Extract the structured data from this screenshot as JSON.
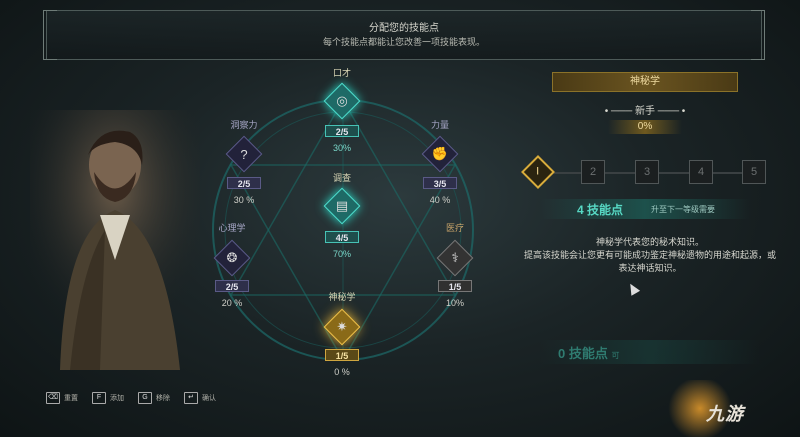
{
  "header": {
    "title": "分配您的技能点",
    "subtitle": "每个技能点都能让您改善一项技能表现。"
  },
  "skills": [
    {
      "id": "eloquence",
      "name": "口才",
      "level": "2/5",
      "percent": "30%",
      "style": "teal",
      "icon": "coins-icon"
    },
    {
      "id": "perception",
      "name": "洞察力",
      "level": "2/5",
      "percent": "30 %",
      "style": "violet",
      "icon": "question-icon"
    },
    {
      "id": "strength",
      "name": "力量",
      "level": "3/5",
      "percent": "40 %",
      "style": "violet",
      "icon": "fist-icon"
    },
    {
      "id": "investigation",
      "name": "调查",
      "level": "4/5",
      "percent": "70%",
      "style": "teal",
      "icon": "documents-icon"
    },
    {
      "id": "psychology",
      "name": "心理学",
      "level": "2/5",
      "percent": "20 %",
      "style": "violet",
      "icon": "brain-icon"
    },
    {
      "id": "medicine",
      "name": "医疗",
      "level": "1/5",
      "percent": "10%",
      "style": "gray",
      "icon": "caduceus-icon"
    },
    {
      "id": "occultism",
      "name": "神秘学",
      "level": "1/5",
      "percent": "0 %",
      "style": "gold",
      "icon": "tome-icon"
    }
  ],
  "detail": {
    "skill_name": "神秘学",
    "rank": "新手",
    "rank_percent": "0%",
    "tiers": [
      "I",
      "2",
      "3",
      "4",
      "5"
    ],
    "active_tier": 0,
    "points_main": "4 技能点",
    "points_sub": "升至下一等级需要",
    "description_line1": "神秘学代表您的秘术知识。",
    "description_line2": "提高该技能会让您更有可能成功鉴定神秘遗物的用途和起源，或表达神话知识。",
    "points_available": "0 技能点",
    "points_available_suffix": "可"
  },
  "controls": [
    {
      "key": "⌫",
      "label": "重置"
    },
    {
      "key": "F",
      "label": "添加"
    },
    {
      "key": "G",
      "label": "移除"
    },
    {
      "key": "↵",
      "label": "确认"
    }
  ],
  "watermark": "九游",
  "colors": {
    "teal": "#4ee0cf",
    "gold": "#e6b337",
    "violet": "#5b5b8a"
  }
}
